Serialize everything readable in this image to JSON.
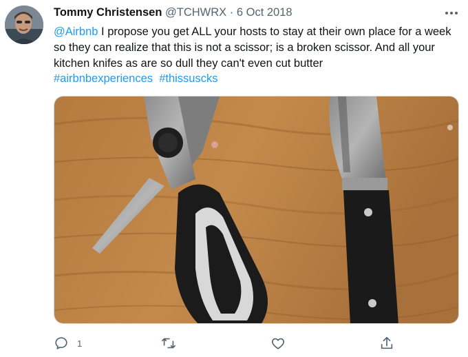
{
  "tweet": {
    "author_name": "Tommy Christensen",
    "handle": "@TCHWRX",
    "separator": "·",
    "date": "6 Oct 2018",
    "text": {
      "mention": "@Airbnb",
      "body": " I propose you get ALL your hosts to stay at their own place for a week so they can realize that this is not a scissor; is a broken scissor. And all your kitchen knifes as are so dull they can't even cut butter",
      "hashtags": [
        "#airbnbexperiences",
        "#thissuscks"
      ]
    },
    "media": {
      "description_icon": "photo-of-broken-scissor-and-knife"
    },
    "actions": {
      "reply_count": "1",
      "retweet_count": "",
      "like_count": ""
    }
  },
  "icons": {
    "more": "more-icon",
    "reply": "reply-icon",
    "retweet": "retweet-icon",
    "like": "heart-icon",
    "share": "share-icon"
  },
  "colors": {
    "link": "#1d9bf0",
    "secondary_text": "#536471",
    "primary_text": "#0f1419"
  }
}
